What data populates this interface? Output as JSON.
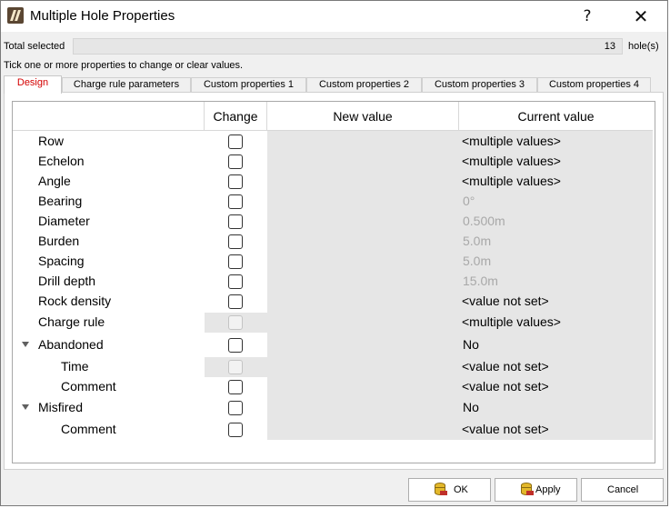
{
  "window": {
    "title": "Multiple Hole Properties",
    "help": "?",
    "close": "✕"
  },
  "summary": {
    "total_label": "Total selected",
    "total_value": "13",
    "unit": "hole(s)",
    "instruction": "Tick one or more properties to change or clear values."
  },
  "tabs": [
    {
      "label": "Design",
      "active": true
    },
    {
      "label": "Charge rule parameters"
    },
    {
      "label": "Custom properties 1"
    },
    {
      "label": "Custom properties 2"
    },
    {
      "label": "Custom properties 3"
    },
    {
      "label": "Custom properties 4"
    }
  ],
  "grid": {
    "headers": {
      "property": "",
      "change": "Change",
      "new_value": "New value",
      "current_value": "Current value"
    },
    "rows": [
      {
        "name": "Row",
        "current": "<multiple values>"
      },
      {
        "name": "Echelon",
        "current": "<multiple values>"
      },
      {
        "name": "Angle",
        "current": "<multiple values>"
      },
      {
        "name": "Bearing",
        "current": "0°"
      },
      {
        "name": "Diameter",
        "current": "0.500m"
      },
      {
        "name": "Burden",
        "current": "5.0m"
      },
      {
        "name": "Spacing",
        "current": "5.0m"
      },
      {
        "name": "Drill depth",
        "current": "15.0m"
      },
      {
        "name": "Rock density",
        "current": "<value not set>"
      },
      {
        "name": "Charge rule",
        "current": "<multiple values>"
      },
      {
        "name": "Abandoned",
        "current": "No"
      },
      {
        "name": "Time",
        "current": "<value not set>"
      },
      {
        "name": "Comment",
        "current": "<value not set>"
      },
      {
        "name": "Misfired",
        "current": "No"
      },
      {
        "name": "Comment",
        "current": "<value not set>"
      }
    ]
  },
  "buttons": {
    "ok": "OK",
    "apply": "Apply",
    "cancel": "Cancel"
  },
  "colors": {
    "active_tab_text": "#d40000",
    "readonly_cell": "#e6e6e6",
    "inherited_value": "#a8a8a8"
  }
}
